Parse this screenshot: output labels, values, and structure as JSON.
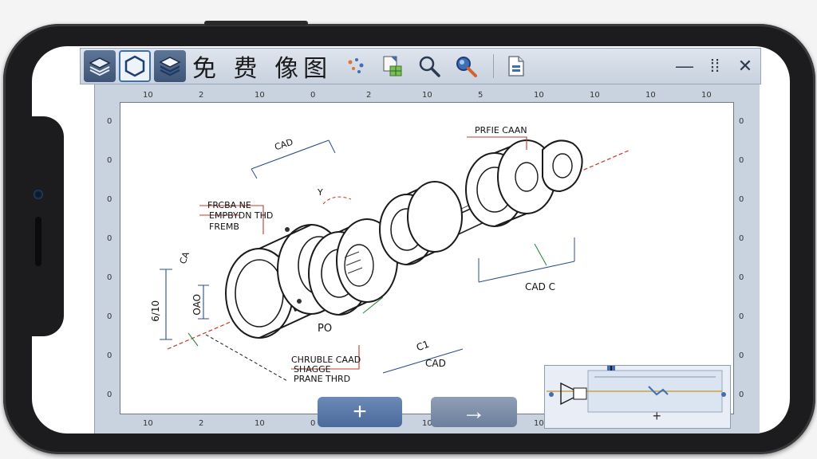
{
  "app": {
    "title": "免 费 像图"
  },
  "toolbar": {
    "buttons": [
      {
        "name": "layers-icon"
      },
      {
        "name": "hexagon-select-icon"
      },
      {
        "name": "layer-stack-icon"
      },
      {
        "name": "sparkle-tool-icon"
      },
      {
        "name": "grid-export-icon"
      },
      {
        "name": "zoom-icon"
      },
      {
        "name": "zoom-selected-icon"
      },
      {
        "name": "document-icon"
      }
    ],
    "window_controls": {
      "minimize": "—",
      "grid": "⁞⁞",
      "close": "✕"
    }
  },
  "rulers": {
    "top": [
      "10",
      "2",
      "10",
      "0",
      "2",
      "10",
      "5",
      "10",
      "10",
      "10",
      "10"
    ],
    "bottom": [
      "10",
      "2",
      "10",
      "0",
      "2",
      "10",
      "10",
      "10",
      "10",
      "10",
      "10"
    ],
    "left": [
      "0",
      "0",
      "0",
      "0",
      "0",
      "0",
      "0",
      "0"
    ],
    "right": [
      "0",
      "0",
      "0",
      "0",
      "0",
      "0",
      "0",
      "0"
    ]
  },
  "drawing": {
    "labels": {
      "top_right": "PRFIE CAAN",
      "top_left_dim": "CAD",
      "y_mark": "Y",
      "left_block": [
        "FRCBA NE",
        "EMPBYDN THD",
        "FREMB"
      ],
      "left_mark": "CA",
      "left_dim_1": "6/10",
      "left_dim_2": "OAO",
      "center_mark": "PO",
      "right_dim": "CAD  C",
      "bottom_block": [
        "CHRUBLE CAAD",
        "SHAGGE",
        "PRANE THRD"
      ],
      "bottom_dim": "CAD",
      "bottom_mark": "C1"
    }
  },
  "actions": {
    "add": "+",
    "next": "→"
  },
  "minimap": {
    "plus": "+"
  },
  "colors": {
    "accent": "#3e6fb5",
    "frame": "#1c1c1e",
    "toolbar": "#c8d1de",
    "dimension_red": "#c0392b",
    "dimension_blue": "#2a4f8a",
    "centerline_green": "#2e8b3a"
  }
}
